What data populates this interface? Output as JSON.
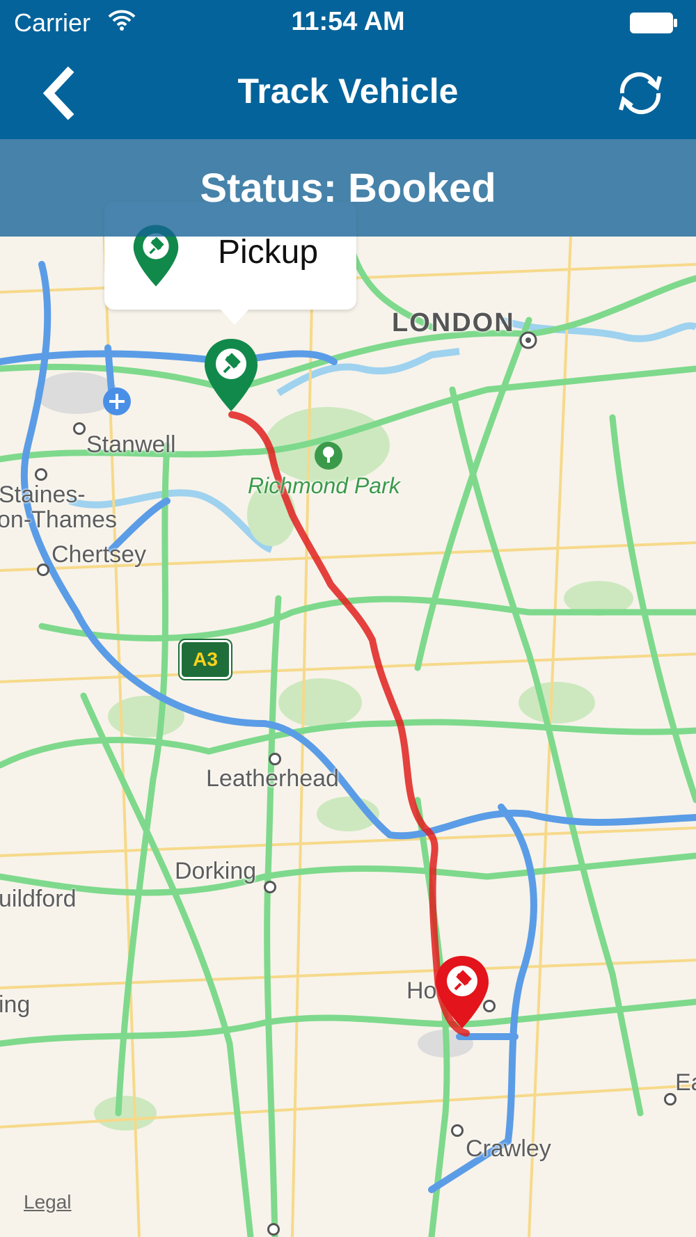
{
  "status_bar": {
    "carrier": "Carrier",
    "time": "11:54 AM"
  },
  "nav": {
    "title": "Track Vehicle",
    "back_icon": "chevron-left-icon",
    "refresh_icon": "refresh-icon"
  },
  "status_banner": {
    "text": "Status: Booked"
  },
  "callout": {
    "label": "Pickup",
    "icon": "green-pin-icon"
  },
  "map": {
    "labels": {
      "london": "LONDON",
      "stanwell": "Stanwell",
      "richmond_park": "Richmond Park",
      "staines_1": "Staines-",
      "staines_2": "on-Thames",
      "chertsey": "Chertsey",
      "a3": "A3",
      "leatherhead": "Leatherhead",
      "dorking": "Dorking",
      "guildford": "uildford",
      "ing": "ing",
      "horley": "Ho",
      "crawley": "Crawley",
      "ea": "Ea"
    },
    "legal": "Legal",
    "colors": {
      "header": "#04639a",
      "route": "#e0201e",
      "pickup_pin": "#11894a",
      "dropoff_pin": "#e3141b",
      "green_road": "#7ed98c",
      "blue_road": "#5b9ce6",
      "yellow_road": "#f6d98a"
    }
  }
}
